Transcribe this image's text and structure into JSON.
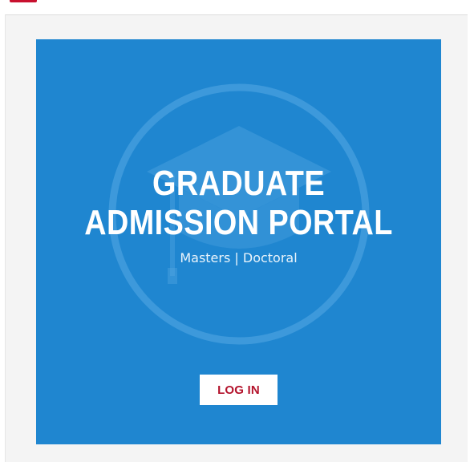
{
  "portal": {
    "title_line_1": "GRADUATE",
    "title_line_2": "ADMISSION PORTAL",
    "subtitle": "Masters | Doctoral",
    "login_label": "LOG IN"
  },
  "icons": {
    "emblem": "graduation-cap-icon"
  },
  "colors": {
    "panel_background": "#1f86d0",
    "button_text": "#b3122b",
    "brand_red": "#c8102e",
    "page_background": "#f4f4f4"
  }
}
